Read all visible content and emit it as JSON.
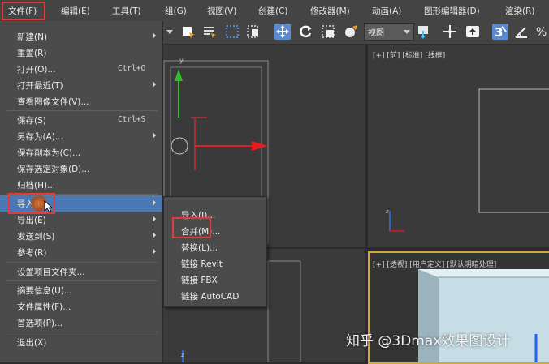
{
  "menubar": {
    "items": [
      "文件(F)",
      "编辑(E)",
      "工具(T)",
      "组(G)",
      "视图(V)",
      "创建(C)",
      "修改器(M)",
      "动画(A)",
      "图形编辑器(D)",
      "渲染(R)"
    ]
  },
  "toolbar": {
    "view_select": "视图"
  },
  "viewports": {
    "front_label": "[+] [前] [标准] [线框]",
    "persp_label": "[+] [透视] [用户定义] [默认明暗处理]"
  },
  "file_menu": {
    "items": [
      {
        "label": "新建(N)",
        "shortcut": "",
        "submenu": true
      },
      {
        "label": "重置(R)",
        "shortcut": "",
        "submenu": false
      },
      {
        "label": "打开(O)...",
        "shortcut": "Ctrl+O",
        "submenu": false
      },
      {
        "label": "打开最近(T)",
        "shortcut": "",
        "submenu": true
      },
      {
        "label": "查看图像文件(V)...",
        "shortcut": "",
        "submenu": false
      },
      {
        "label": "保存(S)",
        "shortcut": "Ctrl+S",
        "submenu": false
      },
      {
        "label": "另存为(A)...",
        "shortcut": "",
        "submenu": true
      },
      {
        "label": "保存副本为(C)...",
        "shortcut": "",
        "submenu": false
      },
      {
        "label": "保存选定对象(D)...",
        "shortcut": "",
        "submenu": false
      },
      {
        "label": "归档(H)...",
        "shortcut": "",
        "submenu": false
      },
      {
        "label": "导入(I)",
        "shortcut": "",
        "submenu": true
      },
      {
        "label": "导出(E)",
        "shortcut": "",
        "submenu": true
      },
      {
        "label": "发送到(S)",
        "shortcut": "",
        "submenu": true
      },
      {
        "label": "参考(R)",
        "shortcut": "",
        "submenu": true
      },
      {
        "label": "设置项目文件夹...",
        "shortcut": "",
        "submenu": false
      },
      {
        "label": "摘要信息(U)...",
        "shortcut": "",
        "submenu": false
      },
      {
        "label": "文件属性(F)...",
        "shortcut": "",
        "submenu": false
      },
      {
        "label": "首选项(P)...",
        "shortcut": "",
        "submenu": false
      },
      {
        "label": "退出(X)",
        "shortcut": "",
        "submenu": false
      }
    ]
  },
  "import_submenu": {
    "items": [
      "导入(I)...",
      "合并(M)...",
      "替换(L)...",
      "链接 Revit",
      "链接 FBX",
      "链接 AutoCAD"
    ]
  },
  "watermark": "知乎 @3Dmax效果图设计",
  "colors": {
    "highlight": "#4a78b5",
    "annotation_red": "#e23b3b",
    "menu_bg": "#4b4b4b",
    "viewport_bg": "#3a3a3a",
    "active_border": "#d7a830"
  }
}
